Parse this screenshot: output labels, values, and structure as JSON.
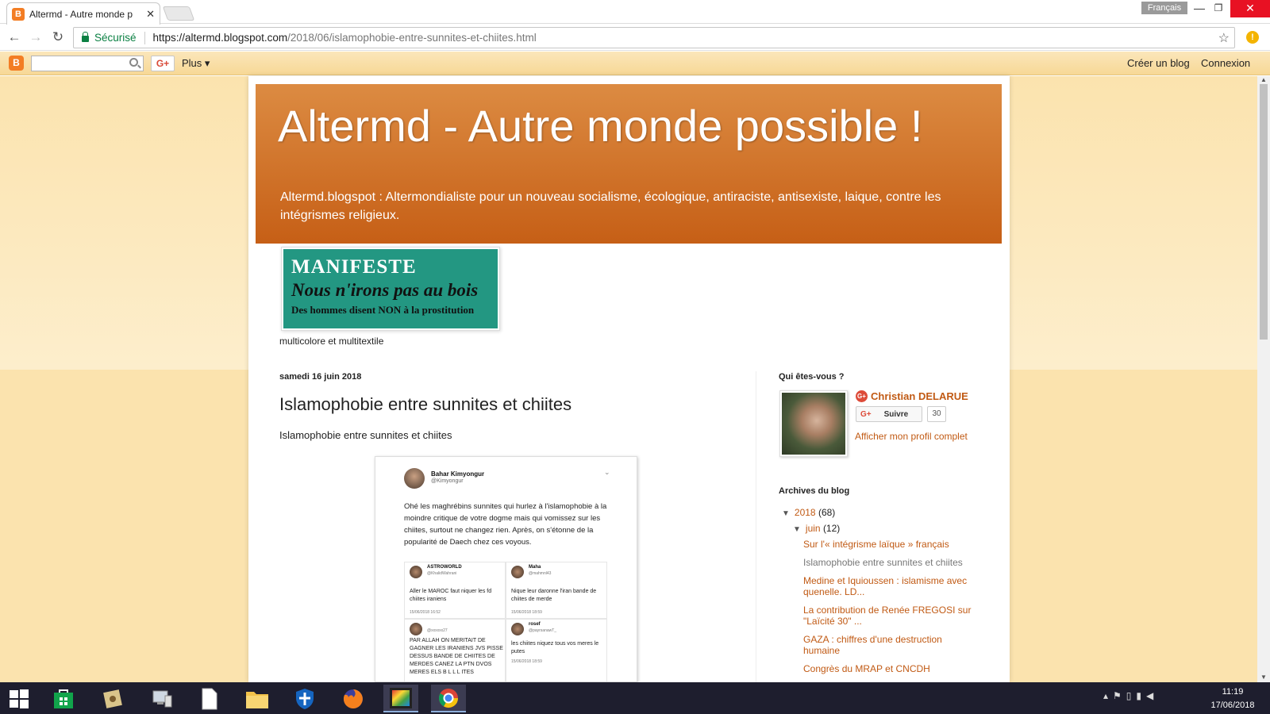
{
  "browser": {
    "tab_title": "Altermd - Autre monde p",
    "lang_badge": "Français",
    "secure_label": "Sécurisé",
    "url_host": "https://altermd.blogspot.com",
    "url_path": "/2018/06/islamophobie-entre-sunnites-et-chiites.html"
  },
  "navbar": {
    "more_label": "Plus",
    "create_blog": "Créer un blog",
    "login": "Connexion"
  },
  "blog": {
    "title": "Altermd - Autre monde possible !",
    "description": "Altermd.blogspot : Altermondialiste pour un nouveau socialisme, écologique, antiraciste, antisexiste, laique, contre les intégrismes religieux.",
    "banner": {
      "line1": "MANIFESTE",
      "line2": "Nous n'irons pas au bois",
      "line3": "Des hommes disent NON à la prostitution",
      "caption": "multicolore et multitextile"
    }
  },
  "post": {
    "date": "samedi 16 juin 2018",
    "title": "Islamophobie entre sunnites et chiites",
    "body": "Islamophobie entre sunnites et chiites",
    "tweet": {
      "name": "Bahar Kimyongur",
      "handle": "@Kimyongur",
      "text": "Ohé les maghrébins sunnites qui hurlez à l'islamophobie à la moindre critique de votre dogme mais qui vomissez sur les chiites, surtout ne changez rien. Après, on s'étonne de la popularité de Daech chez ces voyous.",
      "replies": [
        {
          "name": "ASTROWORLD",
          "handle": "@KhalidWahrani",
          "text": "Aller le MAROC faut niquer les fd chiites iraniens",
          "time": "15/06/2018 16:52"
        },
        {
          "name": "Maha",
          "handle": "@mahmnl43",
          "text": "Nique leur daronne l'iran bande de chiites de merde",
          "time": "15/06/2018 18:59"
        },
        {
          "name": "",
          "handle": "@xxxxxx27",
          "text": "PAR ALLAH ON MERITAIT DE GAGNER LES IRANIENS JVS PISSE DESSUS BANDE DE CHIITES DE MERDES CANEZ LA PTN DVOS MERES ELS B L L L ITES",
          "time": ""
        },
        {
          "name": "rosef",
          "handle": "@payrsanawT_",
          "text": "les chiites niquez tous vos meres le putes",
          "time": "15/06/2018 18:59"
        }
      ]
    }
  },
  "sidebar": {
    "about_title": "Qui êtes-vous ?",
    "profile_name": "Christian DELARUE",
    "follow_label": "Suivre",
    "follow_count": "30",
    "profile_link": "Afficher mon profil complet",
    "archives_title": "Archives du blog",
    "year": {
      "label": "2018",
      "count": "(68)"
    },
    "month": {
      "label": "juin",
      "count": "(12)"
    },
    "posts": [
      "Sur l'« intégrisme laïque » français",
      "Islamophobie entre sunnites et chiites",
      "Medine et Iquioussen : islamisme avec quenelle. LD...",
      "La contribution de Renée FREGOSI sur \"Laïcité 30\" ...",
      "GAZA : chiffres d'une destruction humaine",
      "Congrès du MRAP et CNCDH"
    ]
  },
  "taskbar": {
    "time": "11:19",
    "date": "17/06/2018"
  }
}
